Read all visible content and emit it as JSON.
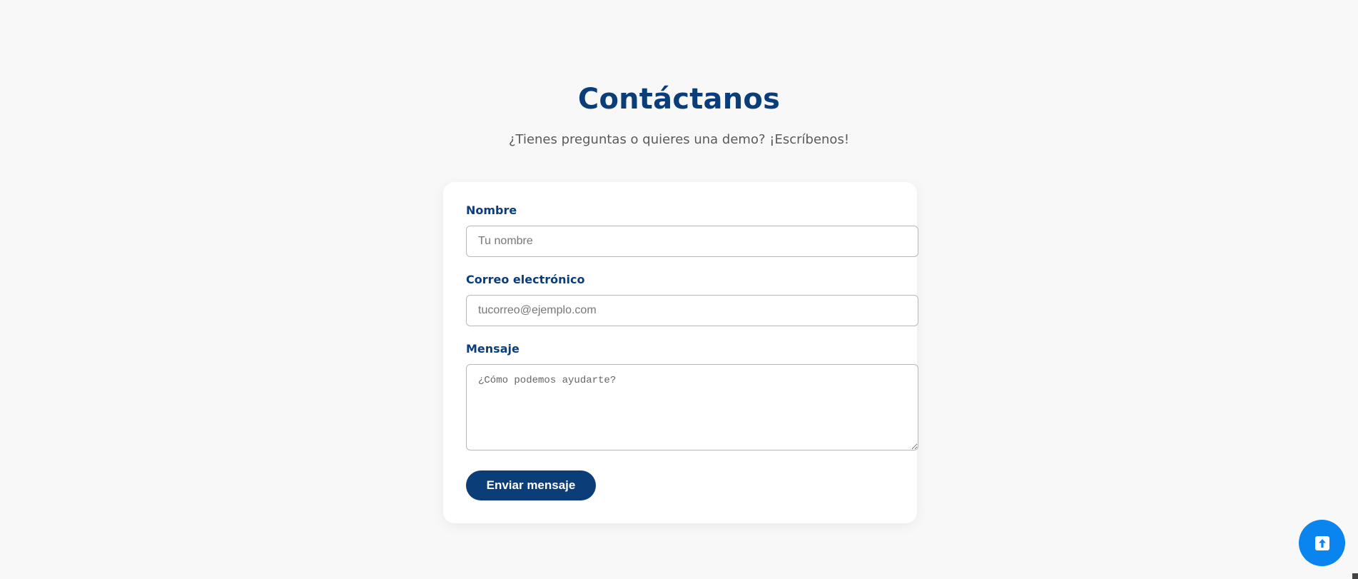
{
  "header": {
    "title": "Contáctanos",
    "subtitle": "¿Tienes preguntas o quieres una demo? ¡Escríbenos!"
  },
  "form": {
    "name_label": "Nombre",
    "name_placeholder": "Tu nombre",
    "name_value": "",
    "email_label": "Correo electrónico",
    "email_placeholder": "tucorreo@ejemplo.com",
    "email_value": "",
    "message_label": "Mensaje",
    "message_placeholder": "¿Cómo podemos ayudarte?",
    "message_value": "",
    "submit_label": "Enviar mensaje"
  },
  "scroll_top_button": {
    "icon": "arrow-up-icon"
  },
  "colors": {
    "primary": "#0b3d78",
    "accent": "#0a84ef",
    "background": "#f8f8f8",
    "card": "#ffffff"
  }
}
